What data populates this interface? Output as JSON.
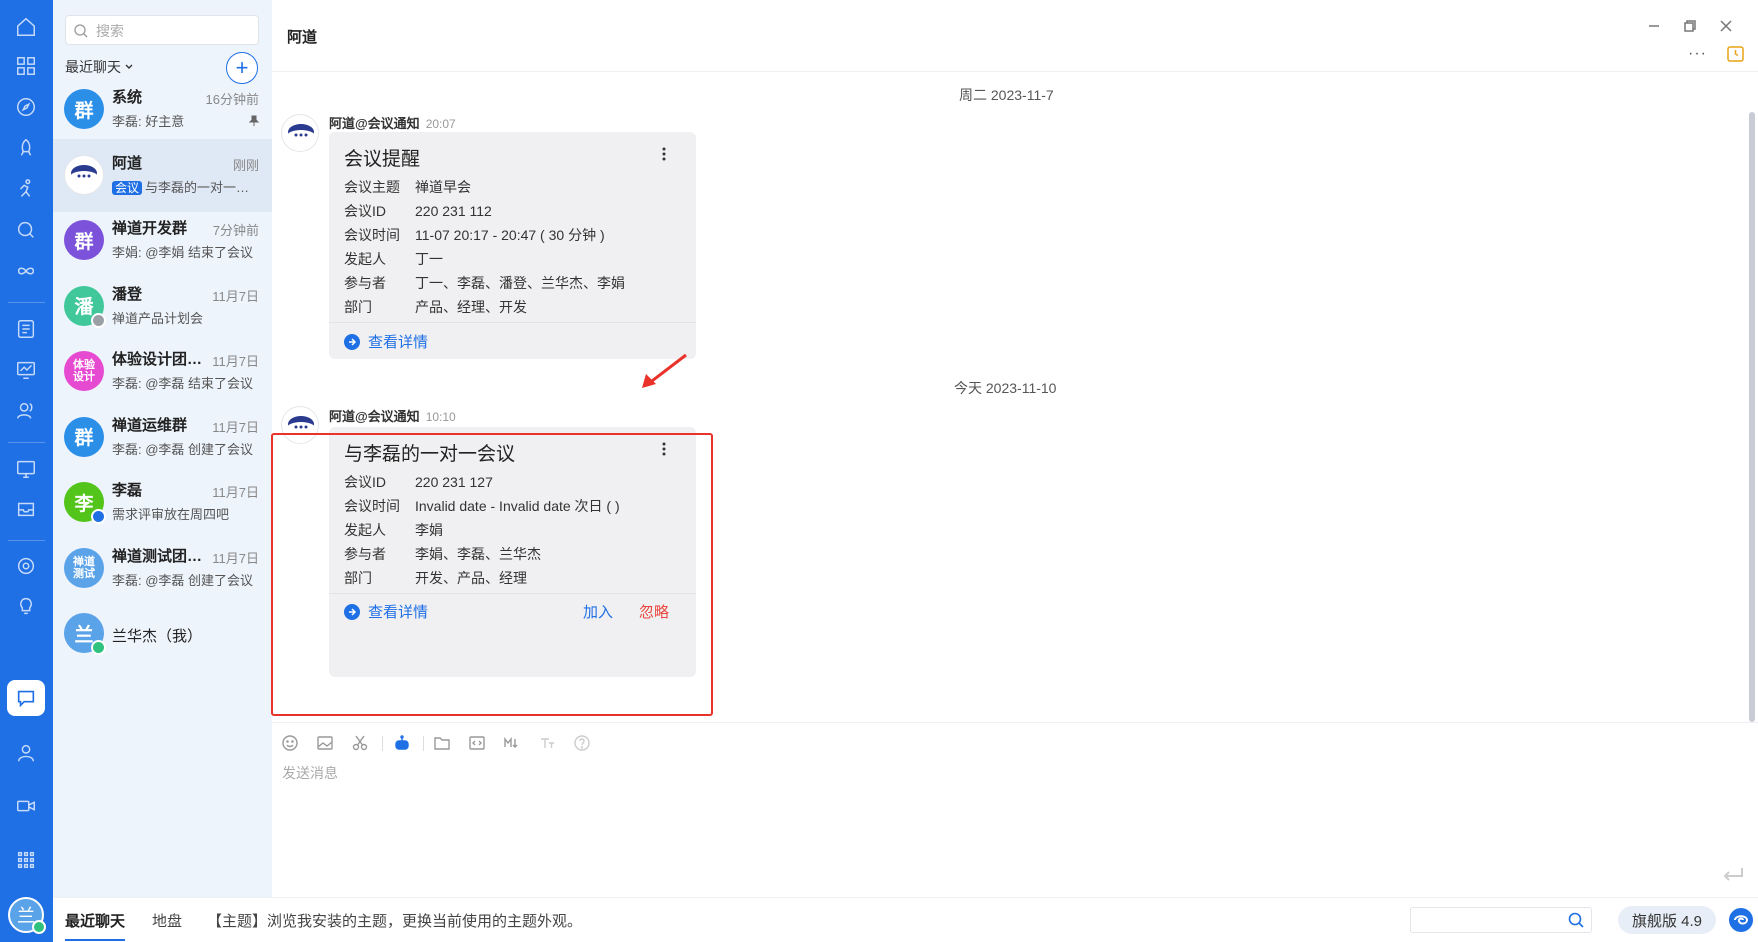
{
  "colors": {
    "brand": "#1f6fe5",
    "danger": "#e8453c",
    "online": "#2ec27e"
  },
  "rail": {
    "icons": [
      "home-icon",
      "apps-grid-icon",
      "compass-icon",
      "rocket-icon",
      "runner-icon",
      "search-icon",
      "infinity-icon",
      "list-doc-icon",
      "chart-screen-icon",
      "team-icon",
      "oa-screen-icon",
      "inbox-icon",
      "gear-icon",
      "bulb-icon",
      "chat-icon",
      "user-icon",
      "video-icon",
      "apps-icon"
    ],
    "user_avatar": "兰"
  },
  "sidebar": {
    "search_placeholder": "搜索",
    "filter_label": "最近聊天",
    "add_label": "+",
    "conversations": [
      {
        "avatar": "群",
        "color": "#2b8fe8",
        "name": "系统",
        "time": "16分钟前",
        "preview": "李磊: 好主意",
        "pinned": true
      },
      {
        "avatar": "",
        "color": "#ffffff",
        "name": "阿道",
        "time": "刚刚",
        "tag": "会议",
        "preview": "与李磊的一对一会议",
        "active": true
      },
      {
        "avatar": "群",
        "color": "#7b52d9",
        "name": "禅道开发群",
        "time": "7分钟前",
        "preview": "李娟: @李娟 结束了会议"
      },
      {
        "avatar": "潘",
        "color": "#41c89a",
        "name": "潘登",
        "time": "11月7日",
        "preview": "禅道产品计划会",
        "status": "#9aa0a6"
      },
      {
        "avatar": "体验设计",
        "color": "#e64ad0",
        "name": "体验设计团队群",
        "time": "11月7日",
        "preview": "李磊: @李磊 结束了会议"
      },
      {
        "avatar": "群",
        "color": "#2b8fe8",
        "name": "禅道运维群",
        "time": "11月7日",
        "preview": "李磊: @李磊 创建了会议"
      },
      {
        "avatar": "李",
        "color": "#52c41a",
        "name": "李磊",
        "time": "11月7日",
        "preview": "需求评审放在周四吧",
        "status": "#1f6fe5"
      },
      {
        "avatar": "禅道测试",
        "color": "#5aa3e8",
        "name": "禅道测试团队群",
        "time": "11月7日",
        "preview": "李磊: @李磊 创建了会议"
      },
      {
        "avatar": "兰",
        "color": "#5aa3e8",
        "name": "兰华杰（我）",
        "time": "",
        "preview": "",
        "status": "#2ec27e"
      }
    ]
  },
  "header": {
    "title": "阿道",
    "more": "···"
  },
  "messages": {
    "dates": [
      "周二 2023-11-7",
      "今天 2023-11-10"
    ],
    "items": [
      {
        "sender": "阿道@会议通知",
        "time": "20:07",
        "card_title": "会议提醒",
        "rows": [
          {
            "k": "会议主题",
            "v": "禅道早会"
          },
          {
            "k": "会议ID",
            "v": "220 231 112"
          },
          {
            "k": "会议时间",
            "v": "11-07 20:17 - 20:47 ( 30 分钟 )"
          },
          {
            "k": "发起人",
            "v": "丁一"
          },
          {
            "k": "参与者",
            "v": "丁一、李磊、潘登、兰华杰、李娟"
          },
          {
            "k": "部门",
            "v": "产品、经理、开发"
          }
        ],
        "link": "查看详情"
      },
      {
        "sender": "阿道@会议通知",
        "time": "10:10",
        "card_title": "与李磊的一对一会议",
        "rows": [
          {
            "k": "会议ID",
            "v": "220 231 127"
          },
          {
            "k": "会议时间",
            "v": "Invalid date - Invalid date 次日 ( )"
          },
          {
            "k": "发起人",
            "v": "李娟"
          },
          {
            "k": "参与者",
            "v": "李娟、李磊、兰华杰"
          },
          {
            "k": "部门",
            "v": "开发、产品、经理"
          }
        ],
        "link": "查看详情",
        "join": "加入",
        "ignore": "忽略"
      }
    ]
  },
  "composer": {
    "tools": [
      "emoji-icon",
      "image-icon",
      "scissors-icon",
      "robot-icon",
      "folder-icon",
      "code-icon",
      "markdown-icon",
      "text-format-icon",
      "help-icon"
    ],
    "placeholder": "发送消息"
  },
  "status_bar": {
    "tabs": [
      "最近聊天",
      "地盘"
    ],
    "tip": "【主题】浏览我安装的主题，更换当前使用的主题外观。",
    "version": "旗舰版 4.9"
  }
}
